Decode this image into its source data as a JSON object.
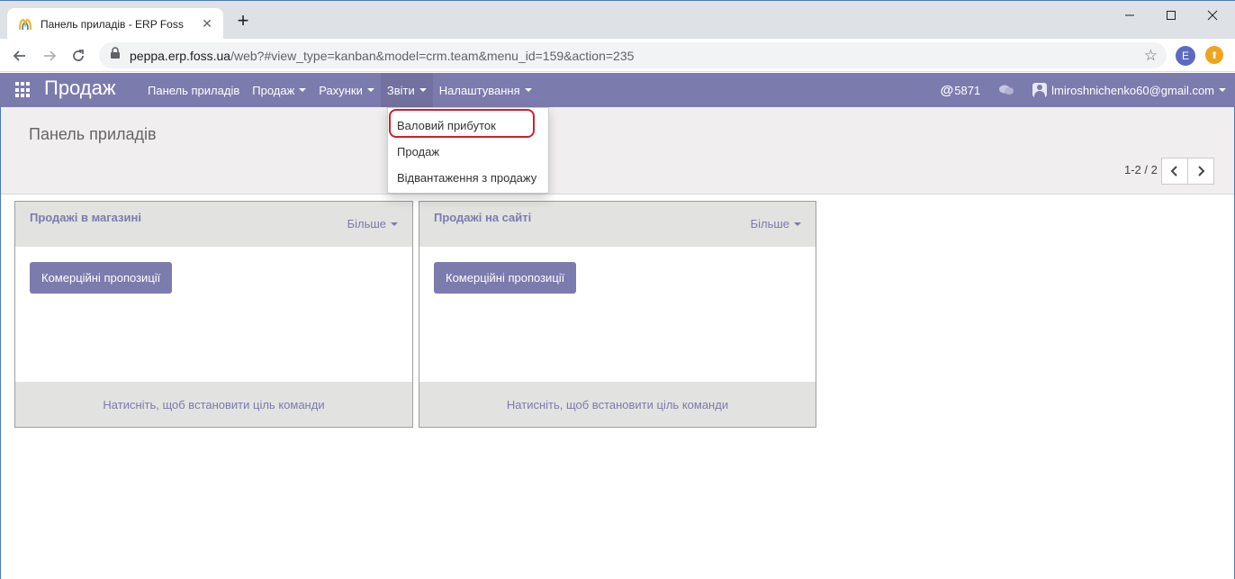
{
  "browser": {
    "tab_title": "Панель приладів - ERP Foss",
    "url_host": "peppa.erp.foss.ua",
    "url_path": "/web?#view_type=kanban&model=crm.team&menu_id=159&action=235",
    "profile_initial": "E"
  },
  "navbar": {
    "brand": "Продаж",
    "menu": [
      {
        "label": "Панель приладів"
      },
      {
        "label": "Продаж"
      },
      {
        "label": "Рахунки"
      },
      {
        "label": "Звіти"
      },
      {
        "label": "Налаштування"
      }
    ],
    "mentions_count": "5871",
    "user_email": "lmiroshnichenko60@gmail.com"
  },
  "reports_dropdown": {
    "items": [
      {
        "label": "Валовий прибуток"
      },
      {
        "label": "Продаж"
      },
      {
        "label": "Відвантаження з продажу"
      }
    ]
  },
  "control_panel": {
    "title": "Панель приладів",
    "pager": "1-2 / 2"
  },
  "teams": [
    {
      "name": "Продажі в магазині",
      "more_label": "Більше",
      "button_label": "Комерційні пропозиції",
      "footer_label": "Натисніть, щоб встановити ціль команди"
    },
    {
      "name": "Продажі на сайті",
      "more_label": "Більше",
      "button_label": "Комерційні пропозиції",
      "footer_label": "Натисніть, щоб встановити ціль команди"
    }
  ],
  "colors": {
    "brand": "#7c7bad",
    "highlight": "#d01f2a"
  }
}
